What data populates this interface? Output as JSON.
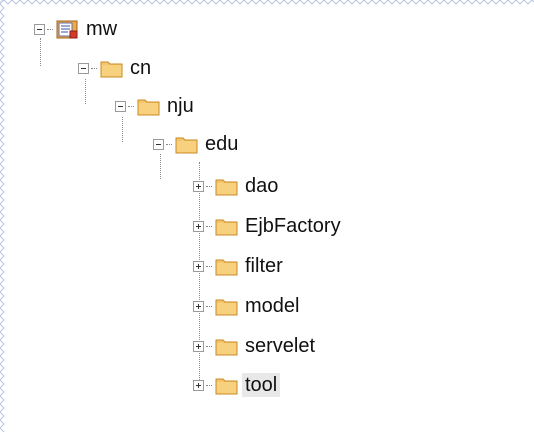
{
  "tree": {
    "root": {
      "label": "mw",
      "icon": "project-icon"
    },
    "nodes": [
      {
        "label": "cn",
        "state": "expanded"
      },
      {
        "label": "nju",
        "state": "expanded"
      },
      {
        "label": "edu",
        "state": "expanded"
      },
      {
        "label": "dao",
        "state": "collapsed"
      },
      {
        "label": "EjbFactory",
        "state": "collapsed"
      },
      {
        "label": "filter",
        "state": "collapsed"
      },
      {
        "label": "model",
        "state": "collapsed"
      },
      {
        "label": "servelet",
        "state": "collapsed"
      },
      {
        "label": "tool",
        "state": "collapsed",
        "selected": true
      }
    ]
  },
  "colors": {
    "folder_fill": "#f4c56f",
    "folder_border": "#c98a22",
    "selection": "#e8e8e8"
  }
}
